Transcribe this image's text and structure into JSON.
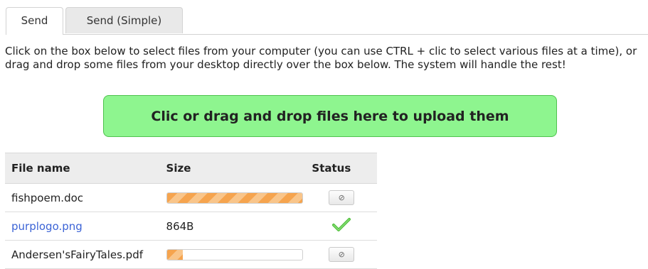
{
  "tabs": [
    {
      "label": "Send",
      "active": true
    },
    {
      "label": "Send (Simple)",
      "active": false
    }
  ],
  "intro_text": "Click on the box below to select files from your computer (you can use CTRL + clic to select various files at a time), or drag and drop some files from your desktop directly over the box below. The system will handle the rest!",
  "dropzone": {
    "label": "Clic or drag and drop files here to upload them",
    "color": "#8ef58f"
  },
  "table": {
    "headers": {
      "name": "File name",
      "size": "Size",
      "status": "Status"
    },
    "rows": [
      {
        "name": "fishpoem.doc",
        "size": "",
        "progress": 1.0,
        "status": "uploading",
        "cancel_icon": "cancel-icon"
      },
      {
        "name": "purplogo.png",
        "size": "864B",
        "progress": null,
        "status": "done",
        "status_icon": "checkmark-icon"
      },
      {
        "name": "Andersen'sFairyTales.pdf",
        "size": "",
        "progress": 0.12,
        "status": "uploading",
        "cancel_icon": "cancel-icon"
      }
    ]
  },
  "colors": {
    "progress": "#f6a44e",
    "link": "#3b63d6",
    "success": "#4fbf3a"
  }
}
